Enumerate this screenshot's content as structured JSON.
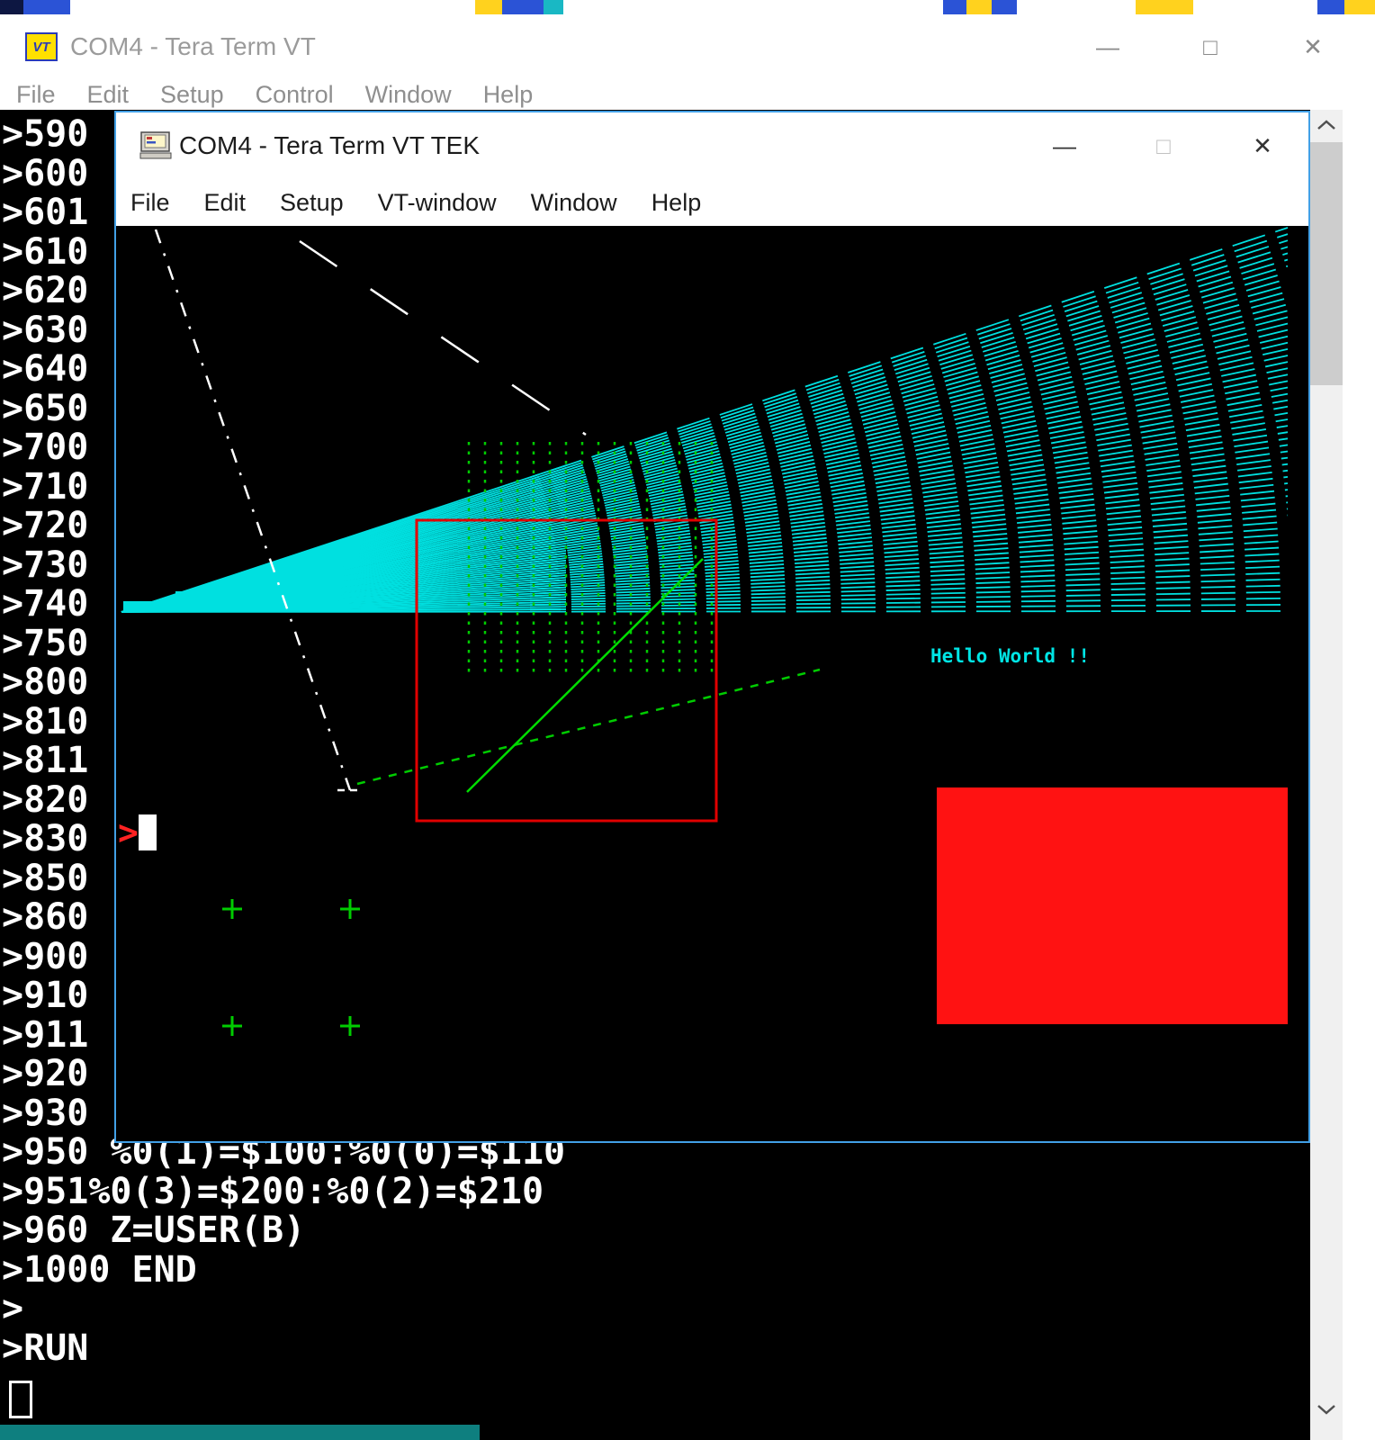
{
  "outer_window": {
    "icon_text": "VT",
    "title": "COM4 - Tera Term VT",
    "menu": [
      "File",
      "Edit",
      "Setup",
      "Control",
      "Window",
      "Help"
    ],
    "controls": {
      "minimize": "—",
      "maximize": "□",
      "close": "✕"
    }
  },
  "tek_window": {
    "title": "COM4 - Tera Term VT TEK",
    "menu": [
      "File",
      "Edit",
      "Setup",
      "VT-window",
      "Window",
      "Help"
    ],
    "controls": {
      "minimize": "—",
      "maximize": "□",
      "close": "✕"
    },
    "canvas": {
      "hello_text": "Hello World !!",
      "prompt": ">"
    }
  },
  "terminal": {
    "left_lines": [
      ">590",
      ">600",
      ">601",
      ">610",
      ">620",
      ">630",
      ">640",
      ">650",
      ">700",
      ">710",
      ">720",
      ">730",
      ">740",
      ">750",
      ">800",
      ">810",
      ">811",
      ">820",
      ">830",
      ">850",
      ">860",
      ">900",
      ">910",
      ">911",
      ">920",
      ">930"
    ],
    "bottom_lines": [
      ">950 %0(1)=$100:%0(0)=$110",
      ">951%0(3)=$200:%0(2)=$210",
      ">960 Z=USER(B)",
      ">1000 END",
      ">",
      ">RUN"
    ]
  },
  "colors": {
    "tek_cyan": "#00e0e0",
    "tek_green": "#00cc00",
    "tek_red": "#ff1212",
    "terminal_fg": "#ffffff",
    "terminal_bg": "#000000",
    "active_border": "#42a0e6"
  }
}
